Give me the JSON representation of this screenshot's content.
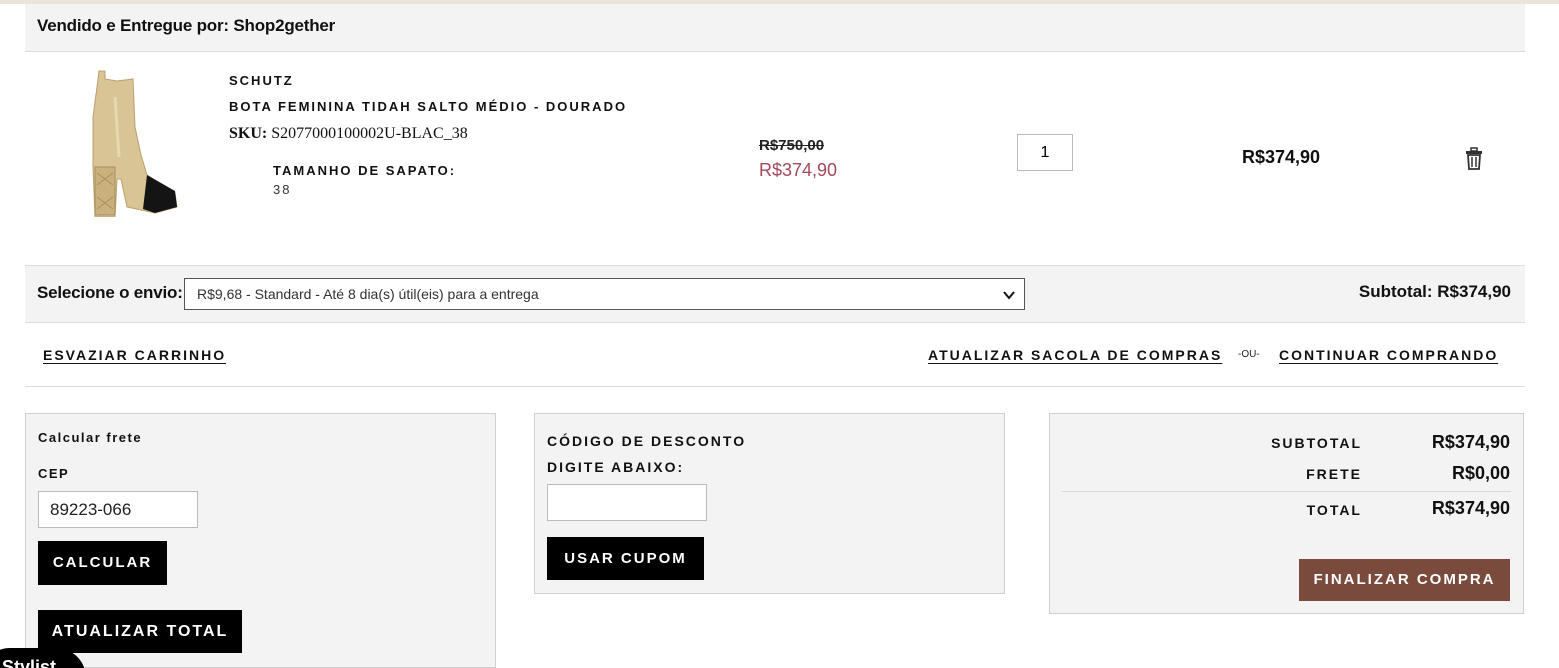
{
  "seller": {
    "label": "Vendido e Entregue por: Shop2gether"
  },
  "item": {
    "image_icon": "product-boot-image",
    "brand": "SCHUTZ",
    "name": "BOTA FEMININA TIDAH SALTO MÉDIO - DOURADO",
    "sku_label": "SKU:",
    "sku_value": "S2077000100002U-BLAC_38",
    "size_label": "TAMANHO DE SAPATO:",
    "size_value": "38",
    "old_price": "R$750,00",
    "new_price": "R$374,90",
    "quantity": "1",
    "line_total": "R$374,90",
    "delete_icon": "trash-icon"
  },
  "shipping": {
    "label": "Selecione o envio:",
    "selected_option": "R$9,68 - Standard - Até 8 dia(s) útil(eis) para a entrega",
    "subtotal_text": "Subtotal: R$374,90"
  },
  "actions": {
    "empty_cart": "ESVAZIAR CARRINHO",
    "update_bag": "ATUALIZAR SACOLA DE COMPRAS",
    "or": "-OU-",
    "continue": "CONTINUAR COMPRANDO"
  },
  "freight": {
    "title": "Calcular frete",
    "cep_label": "CEP",
    "cep_value": "89223-066",
    "calc_button": "CALCULAR",
    "update_total_button": "ATUALIZAR TOTAL"
  },
  "discount": {
    "title": "CÓDIGO DE DESCONTO",
    "subtitle": "DIGITE ABAIXO:",
    "code_value": "",
    "apply_button": "USAR CUPOM"
  },
  "summary": {
    "subtotal_label": "SUBTOTAL",
    "subtotal_value": "R$374,90",
    "freight_label": "FRETE",
    "freight_value": "R$0,00",
    "total_label": "TOTAL",
    "total_value": "R$374,90",
    "checkout_button": "FINALIZAR COMPRA"
  },
  "stylist": {
    "label": "Stylist"
  },
  "colors": {
    "accent_brown": "#7a4a3c",
    "sale_price": "#a2485a",
    "panel_bg": "#f3f3f3"
  }
}
